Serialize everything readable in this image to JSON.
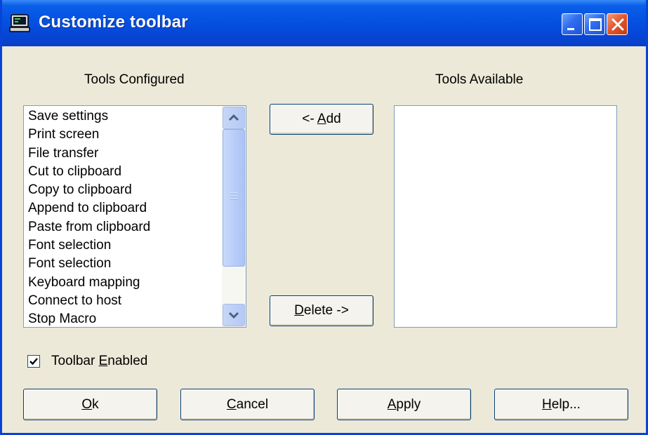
{
  "window": {
    "title": "Customize toolbar"
  },
  "configured": {
    "heading": "Tools Configured",
    "items": [
      "Save settings",
      "Print screen",
      "File transfer",
      "Cut to clipboard",
      "Copy to clipboard",
      "Append to clipboard",
      "Paste from clipboard",
      "Font selection",
      "Font selection",
      "Keyboard mapping",
      "Connect to host",
      "Stop Macro"
    ]
  },
  "available": {
    "heading": "Tools Available",
    "items": []
  },
  "buttons": {
    "add": {
      "prefix": "<- ",
      "mnemonic": "A",
      "rest": "dd"
    },
    "delete": {
      "prefix": "",
      "mnemonic": "D",
      "rest": "elete ->"
    },
    "ok": {
      "mnemonic": "O",
      "rest": "k"
    },
    "cancel": {
      "mnemonic": "C",
      "rest": "ancel"
    },
    "apply": {
      "mnemonic": "A",
      "rest": "pply"
    },
    "help": {
      "mnemonic": "H",
      "rest": "elp..."
    }
  },
  "toolbar_enabled": {
    "prefix": "Toolbar ",
    "mnemonic": "E",
    "rest": "nabled",
    "checked": true
  },
  "colors": {
    "titlebar": "#0553e2",
    "dialog_bg": "#ece9d8",
    "button_border": "#003c74",
    "close_button": "#e1552a"
  }
}
